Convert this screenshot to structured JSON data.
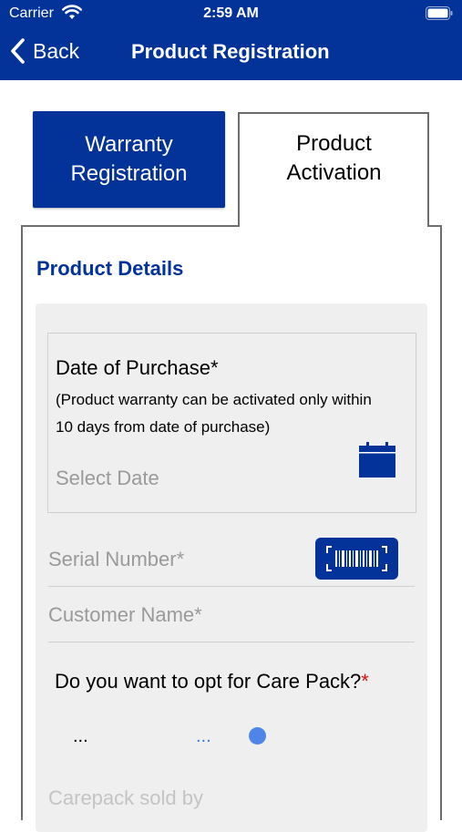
{
  "status_bar": {
    "carrier": "Carrier",
    "time": "2:59 AM"
  },
  "nav": {
    "back_label": "Back",
    "title": "Product Registration"
  },
  "tabs": [
    {
      "label_line1": "Warranty",
      "label_line2": "Registration",
      "active": false
    },
    {
      "label_line1": "Product",
      "label_line2": "Activation",
      "active": true
    }
  ],
  "section": {
    "title": "Product Details"
  },
  "date_of_purchase": {
    "label": "Date of Purchase*",
    "note": "(Product warranty can be activated only within 10 days from date of purchase)",
    "placeholder": "Select Date"
  },
  "fields": {
    "serial_number_placeholder": "Serial Number*",
    "customer_name_placeholder": "Customer Name*",
    "carepack_sold_by_placeholder": "Carepack sold by"
  },
  "carepack": {
    "question": "Do you want to opt for Care Pack?",
    "required_mark": "*",
    "option_a": "...",
    "option_b": "..."
  },
  "colors": {
    "brand": "#033399",
    "required": "#e01010",
    "radio": "#4d86e8"
  }
}
